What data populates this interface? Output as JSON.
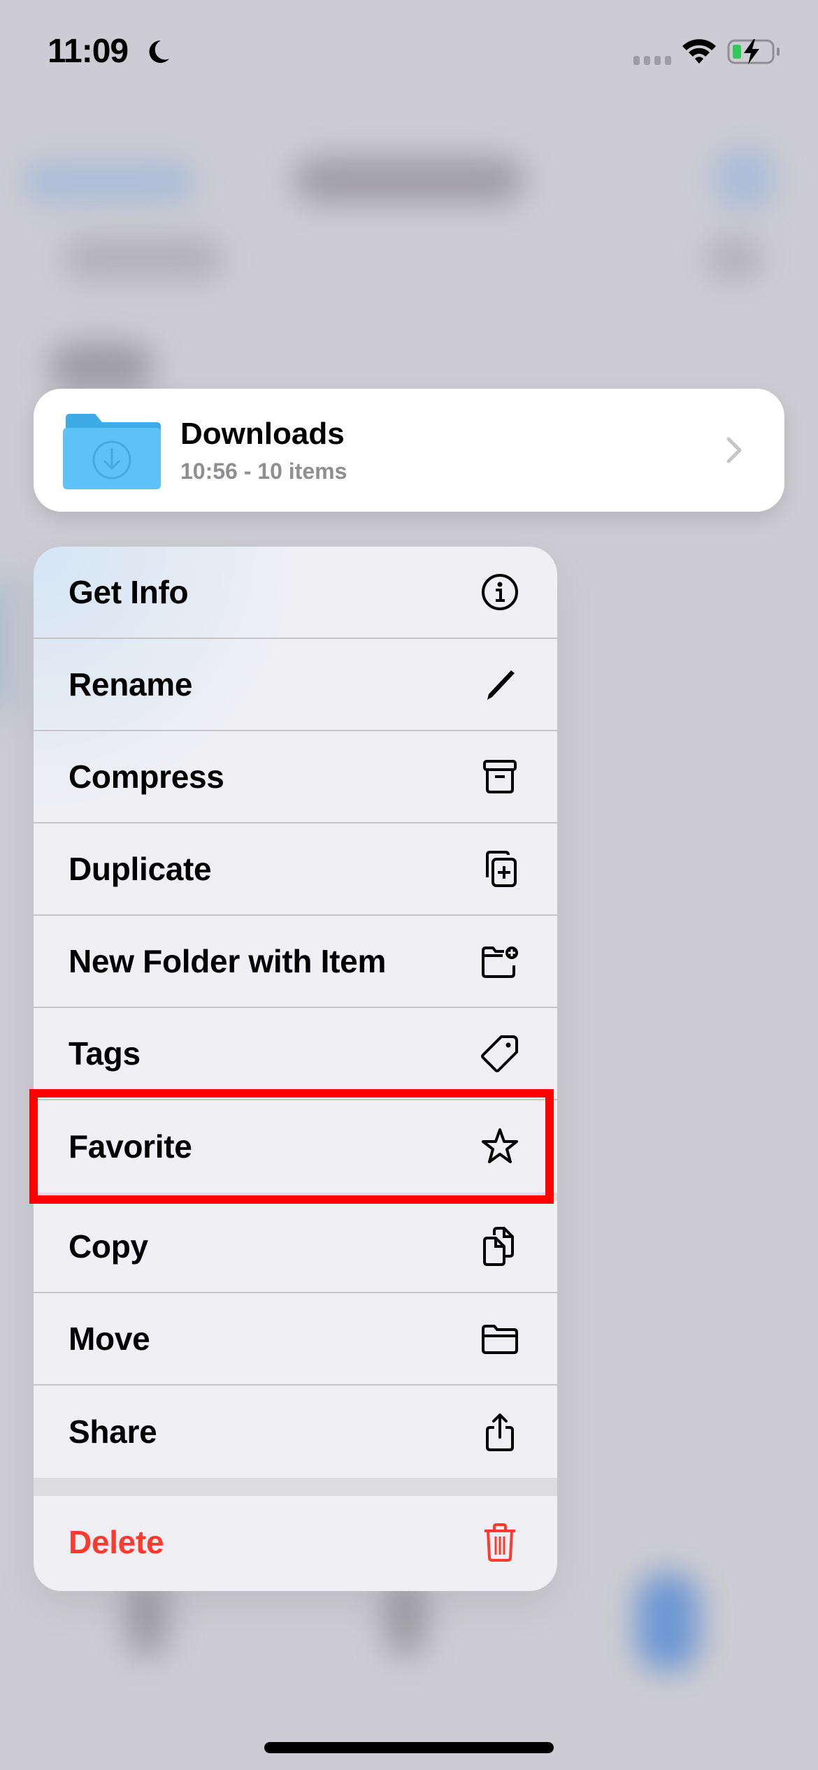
{
  "status_bar": {
    "time": "11:09",
    "focus_icon": "moon-icon",
    "signal_icon": "cellular-signal-icon",
    "wifi_icon": "wifi-icon",
    "battery_icon": "battery-charging-icon",
    "battery_color": "#34c759"
  },
  "preview": {
    "title": "Downloads",
    "subtitle": "10:56 - 10 items",
    "icon": "downloads-folder-icon",
    "chevron": "chevron-right-icon",
    "folder_color": "#5ac0f5"
  },
  "menu": {
    "items": [
      {
        "label": "Get Info",
        "icon": "info-circle-icon"
      },
      {
        "label": "Rename",
        "icon": "pencil-icon"
      },
      {
        "label": "Compress",
        "icon": "archive-box-icon"
      },
      {
        "label": "Duplicate",
        "icon": "duplicate-plus-icon"
      },
      {
        "label": "New Folder with Item",
        "icon": "folder-badge-plus-icon"
      },
      {
        "label": "Tags",
        "icon": "tag-icon"
      },
      {
        "label": "Favorite",
        "icon": "star-icon",
        "highlighted": true
      },
      {
        "label": "Copy",
        "icon": "copy-documents-icon"
      },
      {
        "label": "Move",
        "icon": "folder-icon"
      },
      {
        "label": "Share",
        "icon": "share-icon"
      }
    ],
    "destructive": {
      "label": "Delete",
      "icon": "trash-icon",
      "color": "#ff3b30"
    }
  },
  "annotation": {
    "highlight_color": "#ff0000",
    "highlight_target": "Favorite"
  }
}
